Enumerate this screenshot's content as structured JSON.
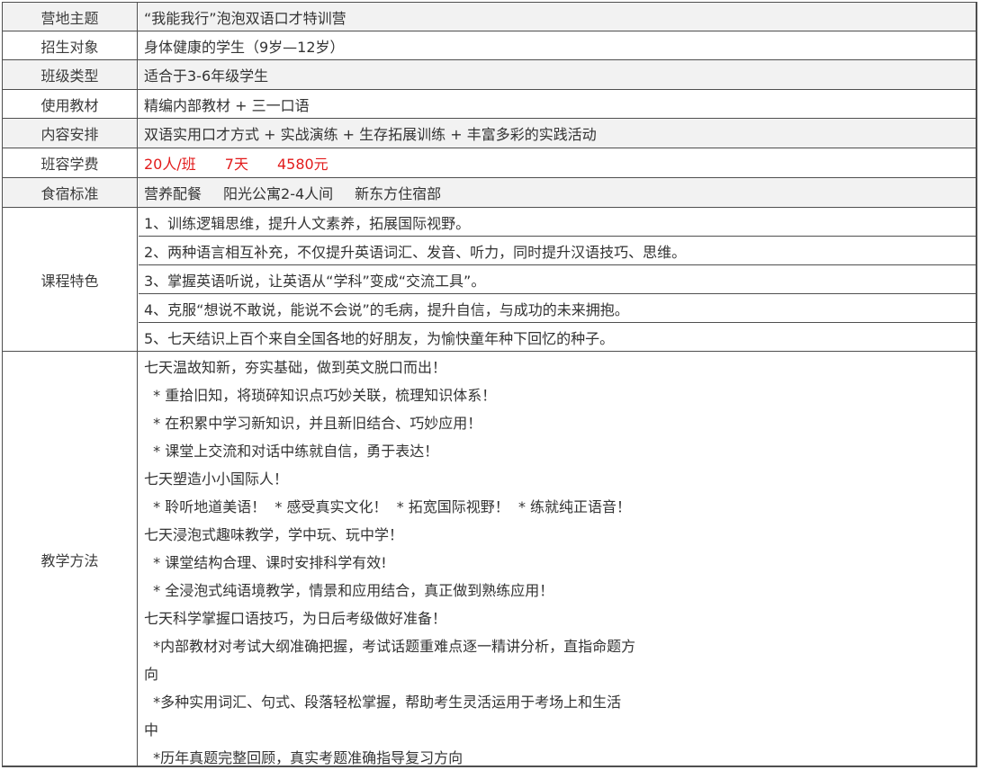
{
  "rows": [
    {
      "label": "营地主题",
      "value": "“我能我行”泡泡双语口才特训营"
    },
    {
      "label": "招生对象",
      "value": "身体健康的学生（9岁—12岁）"
    },
    {
      "label": "班级类型",
      "value": "适合于3-6年级学生"
    },
    {
      "label": "使用教材",
      "value": "精编内部教材 + 三一口语"
    },
    {
      "label": "内容安排",
      "value": "双语实用口才方式 + 实战演练 + 生存拓展训练 + 丰富多彩的实践活动"
    }
  ],
  "fee": {
    "label": "班容学费",
    "class_size": "20人/班",
    "duration": "7天",
    "price": "4580元"
  },
  "accommodation": {
    "label": "食宿标准",
    "items": [
      "营养配餐",
      "阳光公寓2-4人间",
      "新东方住宿部"
    ]
  },
  "features": {
    "label": "课程特色",
    "items": [
      "1、训练逻辑思维，提升人文素养，拓展国际视野。",
      "2、两种语言相互补充，不仅提升英语词汇、发音、听力，同时提升汉语技巧、思维。",
      "3、掌握英语听说，让英语从“学科”变成“交流工具”。",
      "4、克服“想说不敢说，能说不会说”的毛病，提升自信，与成功的未来拥抱。",
      "5、七天结识上百个来自全国各地的好朋友，为愉快童年种下回忆的种子。"
    ]
  },
  "methods": {
    "label": "教学方法",
    "lines": [
      "七天温故知新，夯实基础，做到英文脱口而出！",
      "  * 重拾旧知，将琐碎知识点巧妙关联，梳理知识体系！",
      "  * 在积累中学习新知识，并且新旧结合、巧妙应用！",
      "  * 课堂上交流和对话中练就自信，勇于表达！",
      "七天塑造小小国际人！",
      "  * 聆听地道美语！  * 感受真实文化！  * 拓宽国际视野！  * 练就纯正语音！",
      "七天浸泡式趣味教学，学中玩、玩中学！",
      "  * 课堂结构合理、课时安排科学有效!",
      "  * 全浸泡式纯语境教学，情景和应用结合，真正做到熟练应用！",
      "七天科学掌握口语技巧，为日后考级做好准备！",
      "  *内部教材对考试大纲准确把握，考试话题重难点逐一精讲分析，直指命题方",
      "向",
      "  *多种实用词汇、句式、段落轻松掌握，帮助考生灵活运用于考场上和生活",
      "中",
      "  *历年真题完整回顾，真实考题准确指导复习方向"
    ]
  }
}
